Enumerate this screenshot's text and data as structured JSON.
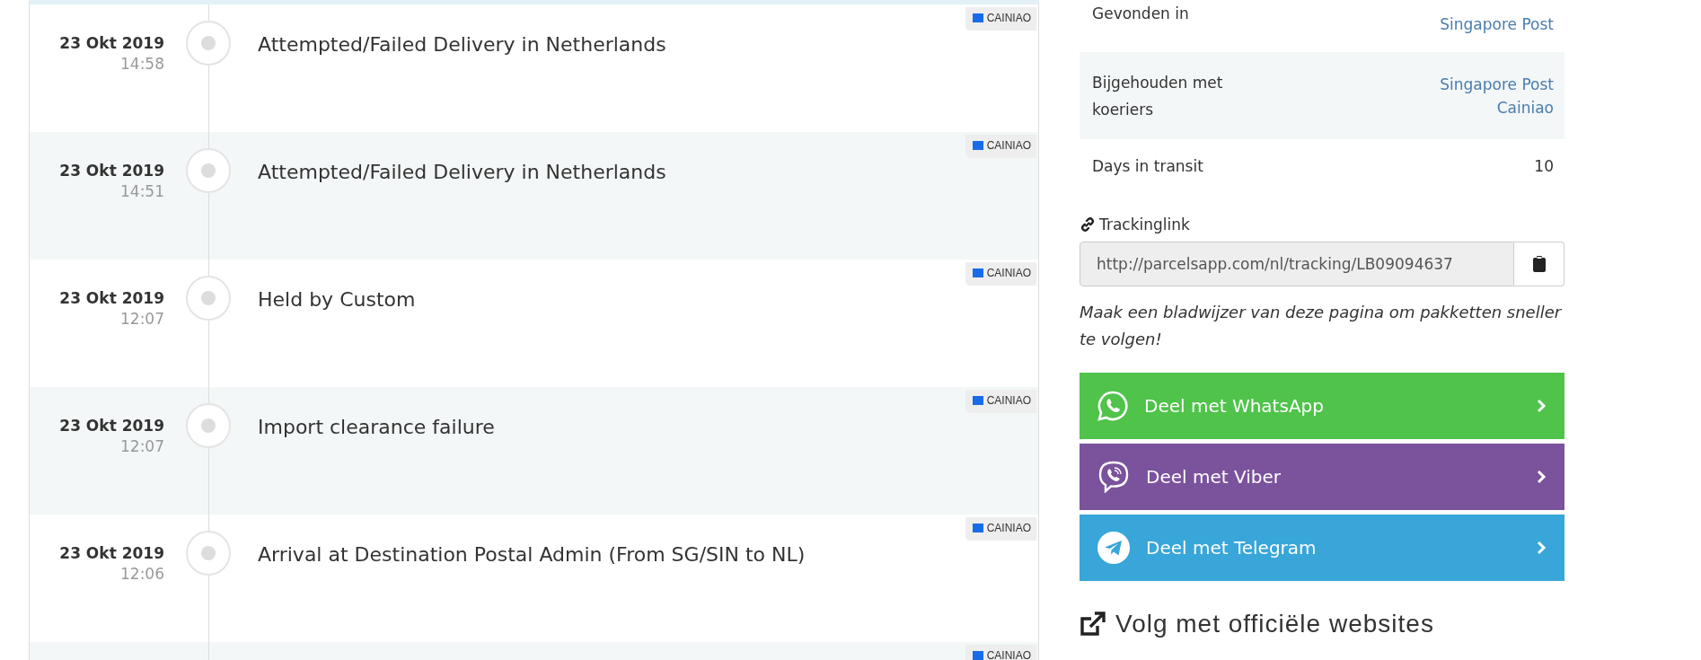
{
  "timeline": [
    {
      "date": "23 Okt 2019",
      "time": "14:58",
      "description": "Attempted/Failed Delivery in Netherlands",
      "carrier": "CAINIAO"
    },
    {
      "date": "23 Okt 2019",
      "time": "14:51",
      "description": "Attempted/Failed Delivery in Netherlands",
      "carrier": "CAINIAO"
    },
    {
      "date": "23 Okt 2019",
      "time": "12:07",
      "description": "Held by Custom",
      "carrier": "CAINIAO"
    },
    {
      "date": "23 Okt 2019",
      "time": "12:07",
      "description": "Import clearance failure",
      "carrier": "CAINIAO"
    },
    {
      "date": "23 Okt 2019",
      "time": "12:06",
      "description": "Arrival at Destination Postal Admin (From SG/SIN to NL)",
      "carrier": "CAINIAO"
    },
    {
      "carrier": "CAINIAO"
    }
  ],
  "details": [
    {
      "label": "Gevonden in",
      "kind": "links",
      "values": [
        "Singapore Post"
      ]
    },
    {
      "label": "Bijgehouden met koeriers",
      "kind": "links",
      "values": [
        "Singapore Post",
        "Cainiao"
      ]
    },
    {
      "label": "Days in transit",
      "kind": "text",
      "values": [
        "10"
      ]
    }
  ],
  "trackinglink": {
    "label": "Trackinglink",
    "value": "http://parcelsapp.com/nl/tracking/LB09094637",
    "note": "Maak een bladwijzer van deze pagina om pakketten sneller te volgen!"
  },
  "share": [
    {
      "kind": "whatsapp",
      "label": "Deel met WhatsApp",
      "color": "#4fc34a"
    },
    {
      "kind": "viber",
      "label": "Deel met Viber",
      "color": "#7b529c"
    },
    {
      "kind": "telegram",
      "label": "Deel met Telegram",
      "color": "#38a6d8"
    }
  ],
  "official": {
    "title": "Volg met officiële websites"
  }
}
